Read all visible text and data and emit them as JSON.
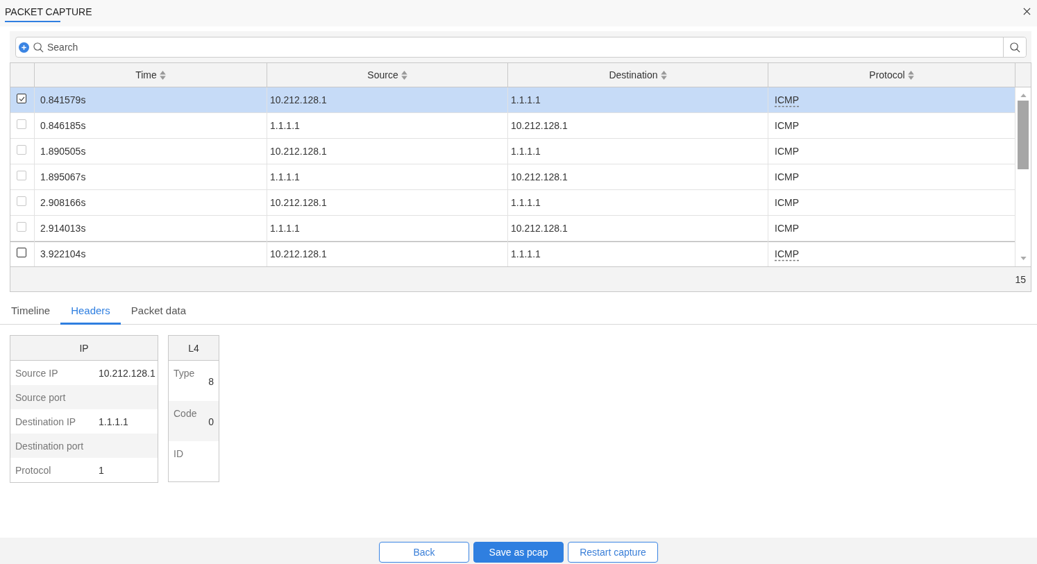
{
  "window": {
    "tabs": [
      {
        "label": "PACKET CAPTURE",
        "selected": true
      }
    ]
  },
  "search": {
    "placeholder": "Search"
  },
  "table": {
    "columns": [
      {
        "label": "Time",
        "sortable": true
      },
      {
        "label": "Source",
        "sortable": true
      },
      {
        "label": "Destination",
        "sortable": true
      },
      {
        "label": "Protocol",
        "sortable": true
      }
    ],
    "rows": [
      {
        "selected": true,
        "checked": true,
        "hovered": false,
        "cells": [
          "0.841579s",
          "10.212.128.1",
          "1.1.1.1",
          "ICMP"
        ]
      },
      {
        "selected": false,
        "checked": false,
        "hovered": false,
        "cells": [
          "0.846185s",
          "1.1.1.1",
          "10.212.128.1",
          "ICMP"
        ]
      },
      {
        "selected": false,
        "checked": false,
        "hovered": false,
        "cells": [
          "1.890505s",
          "10.212.128.1",
          "1.1.1.1",
          "ICMP"
        ]
      },
      {
        "selected": false,
        "checked": false,
        "hovered": false,
        "cells": [
          "1.895067s",
          "1.1.1.1",
          "10.212.128.1",
          "ICMP"
        ]
      },
      {
        "selected": false,
        "checked": false,
        "hovered": false,
        "cells": [
          "2.908166s",
          "10.212.128.1",
          "1.1.1.1",
          "ICMP"
        ]
      },
      {
        "selected": false,
        "checked": false,
        "hovered": false,
        "cells": [
          "2.914013s",
          "1.1.1.1",
          "10.212.128.1",
          "ICMP"
        ]
      },
      {
        "selected": false,
        "checked": false,
        "hovered": true,
        "cells": [
          "3.922104s",
          "10.212.128.1",
          "1.1.1.1",
          "ICMP"
        ]
      }
    ],
    "row_count": "15"
  },
  "detail_tabs": [
    {
      "label": "Timeline",
      "selected": false
    },
    {
      "label": "Headers",
      "selected": true
    },
    {
      "label": "Packet data",
      "selected": false
    }
  ],
  "header_panels": [
    {
      "title": "IP",
      "kind": "inline",
      "fields": [
        {
          "label": "Source IP",
          "value": "10.212.128.1"
        },
        {
          "label": "Source port"
        },
        {
          "label": "Destination IP",
          "value": "1.1.1.1"
        },
        {
          "label": "Destination port"
        },
        {
          "label": "Protocol",
          "value": "1"
        }
      ]
    },
    {
      "title": "L4",
      "kind": "stacked",
      "fields": [
        {
          "label": "Type",
          "value": "8"
        },
        {
          "label": "Code",
          "value": "0"
        },
        {
          "label": "ID"
        }
      ]
    }
  ],
  "buttons": [
    {
      "label": "Back",
      "kind": "secondary"
    },
    {
      "label": "Save as pcap",
      "kind": "primary"
    },
    {
      "label": "Restart capture",
      "kind": "secondary"
    }
  ]
}
